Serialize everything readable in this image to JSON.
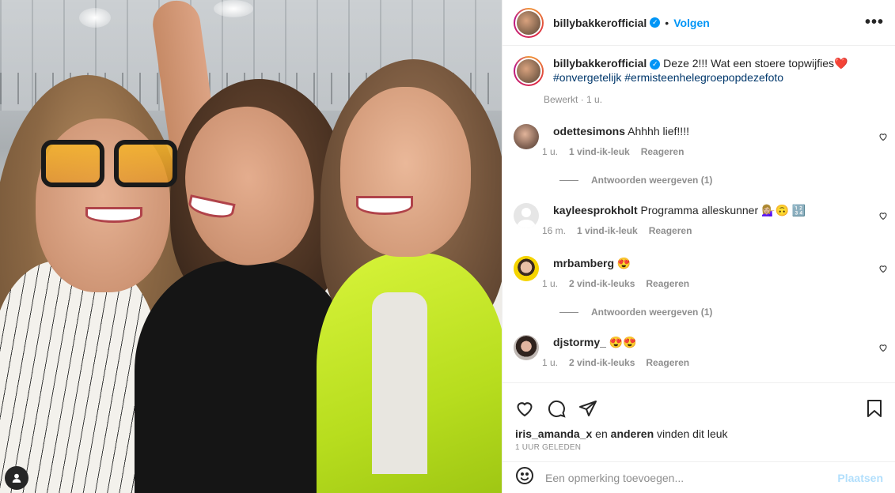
{
  "header": {
    "username": "billybakkerofficial",
    "follow_label": "Volgen",
    "more_icon": "more-horizontal-icon"
  },
  "caption": {
    "username": "billybakkerofficial",
    "text": "Deze 2!!! Wat een stoere topwijfies❤️",
    "hashtags": "#onvergetelijk #ermisteenhelegroepopdezefoto",
    "edited_label": "Bewerkt",
    "separator": "·",
    "time": "1 u."
  },
  "comments": [
    {
      "username": "odettesimons",
      "text": "Ahhhh lief!!!!",
      "time": "1 u.",
      "likes": "1 vind-ik-leuk",
      "reply_label": "Reageren",
      "replies_label": "Antwoorden weergeven (1)",
      "avatar_color": "#8a6a5a"
    },
    {
      "username": "kayleesprokholt",
      "text": "Programma alleskunner 💁🏼‍♀️🙃 🔢",
      "time": "16 m.",
      "likes": "1 vind-ik-leuk",
      "reply_label": "Reageren",
      "avatar_color": "#e0e0e0"
    },
    {
      "username": "mrbamberg",
      "text": "😍",
      "time": "1 u.",
      "likes": "2 vind-ik-leuks",
      "reply_label": "Reageren",
      "replies_label": "Antwoorden weergeven (1)",
      "avatar_color": "#f5d400"
    },
    {
      "username": "djstormy_",
      "text": "😍😍",
      "time": "1 u.",
      "likes": "2 vind-ik-leuks",
      "reply_label": "Reageren",
      "avatar_color": "#5a4a44"
    }
  ],
  "actions": {
    "like_icon": "heart-icon",
    "comment_icon": "comment-icon",
    "share_icon": "send-icon",
    "save_icon": "bookmark-icon"
  },
  "likes": {
    "user": "iris_amanda_x",
    "middle": " en ",
    "others": "anderen",
    "suffix": " vinden dit leuk"
  },
  "posted_time": "1 UUR GELEDEN",
  "add_comment": {
    "placeholder": "Een opmerking toevoegen...",
    "post_label": "Plaatsen",
    "emoji_icon": "smiley-icon"
  },
  "colors": {
    "accent": "#0095f6",
    "hashtag": "#00376b",
    "muted": "#8e8e8e",
    "post_disabled": "#b2dffc"
  }
}
